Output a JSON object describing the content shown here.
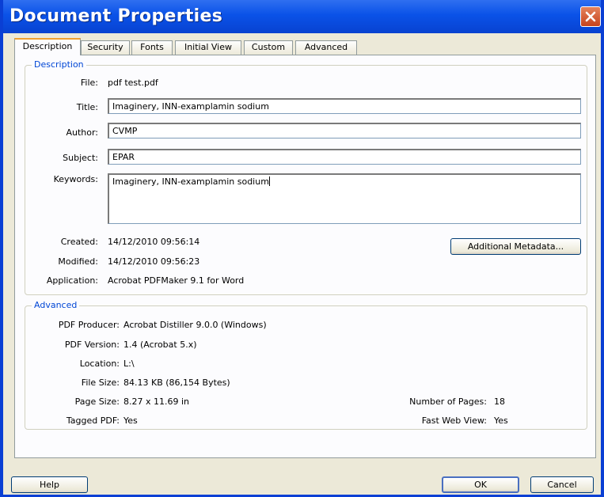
{
  "window": {
    "title": "Document Properties"
  },
  "tabs": [
    "Description",
    "Security",
    "Fonts",
    "Initial View",
    "Custom",
    "Advanced"
  ],
  "description_group": {
    "title": "Description",
    "file_label": "File:",
    "file_value": "pdf test.pdf",
    "title_label": "Title:",
    "title_value": "Imaginery, INN-examplamin sodium",
    "author_label": "Author:",
    "author_value": "CVMP",
    "subject_label": "Subject:",
    "subject_value": "EPAR",
    "keywords_label": "Keywords:",
    "keywords_value": "Imaginery, INN-examplamin sodium",
    "created_label": "Created:",
    "created_value": "14/12/2010 09:56:14",
    "modified_label": "Modified:",
    "modified_value": "14/12/2010 09:56:23",
    "application_label": "Application:",
    "application_value": "Acrobat PDFMaker 9.1 for Word",
    "metadata_button": "Additional Metadata..."
  },
  "advanced_group": {
    "title": "Advanced",
    "producer_label": "PDF Producer:",
    "producer_value": "Acrobat Distiller 9.0.0 (Windows)",
    "version_label": "PDF Version:",
    "version_value": "1.4 (Acrobat 5.x)",
    "location_label": "Location:",
    "location_value": "L:\\",
    "filesize_label": "File Size:",
    "filesize_value": "84.13 KB (86,154 Bytes)",
    "pagesize_label": "Page Size:",
    "pagesize_value": "8.27 x 11.69 in",
    "pages_label": "Number of Pages:",
    "pages_value": "18",
    "tagged_label": "Tagged PDF:",
    "tagged_value": "Yes",
    "fastweb_label": "Fast Web View:",
    "fastweb_value": "Yes"
  },
  "buttons": {
    "help": "Help",
    "ok": "OK",
    "cancel": "Cancel"
  },
  "colors": {
    "titlebar": "#0a52e8",
    "group_title": "#0046d5",
    "close": "#c7431d"
  },
  "icons": {
    "close": "close-icon"
  }
}
